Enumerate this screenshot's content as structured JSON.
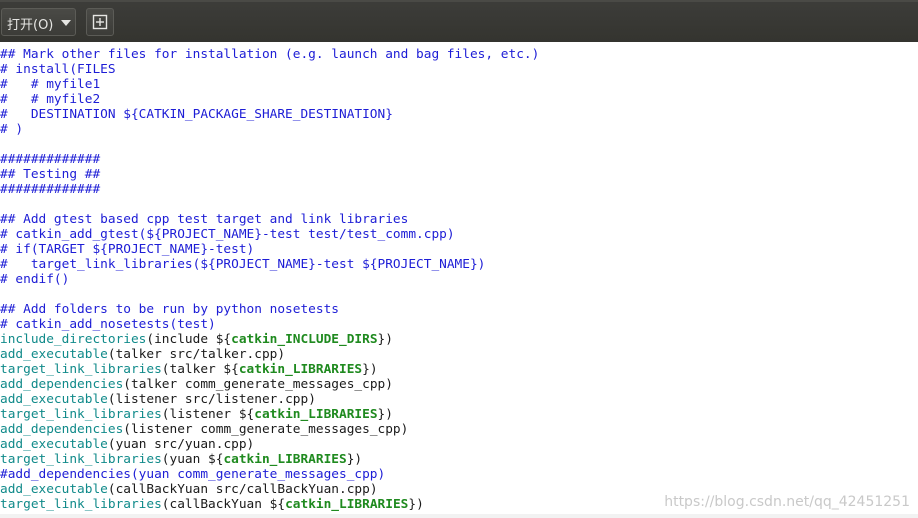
{
  "toolbar": {
    "open_label": "打开(O)",
    "open_icon": "chevron-down-icon",
    "new_icon": "new-document-icon"
  },
  "editor": {
    "lines": [
      [
        {
          "t": "## Mark other files for installation (e.g. launch and bag files, etc.)",
          "c": "comment"
        }
      ],
      [
        {
          "t": "# install(FILES",
          "c": "comment"
        }
      ],
      [
        {
          "t": "#   # myfile1",
          "c": "comment"
        }
      ],
      [
        {
          "t": "#   # myfile2",
          "c": "comment"
        }
      ],
      [
        {
          "t": "#   DESTINATION ${CATKIN_PACKAGE_SHARE_DESTINATION}",
          "c": "comment"
        }
      ],
      [
        {
          "t": "# )",
          "c": "comment"
        }
      ],
      [],
      [
        {
          "t": "#############",
          "c": "comment"
        }
      ],
      [
        {
          "t": "## Testing ##",
          "c": "comment"
        }
      ],
      [
        {
          "t": "#############",
          "c": "comment"
        }
      ],
      [],
      [
        {
          "t": "## Add gtest based cpp test target and link libraries",
          "c": "comment"
        }
      ],
      [
        {
          "t": "# catkin_add_gtest(${PROJECT_NAME}-test test/test_comm.cpp)",
          "c": "comment"
        }
      ],
      [
        {
          "t": "# if(TARGET ${PROJECT_NAME}-test)",
          "c": "comment"
        }
      ],
      [
        {
          "t": "#   target_link_libraries(${PROJECT_NAME}-test ${PROJECT_NAME})",
          "c": "comment"
        }
      ],
      [
        {
          "t": "# endif()",
          "c": "comment"
        }
      ],
      [],
      [
        {
          "t": "## Add folders to be run by python nosetests",
          "c": "comment"
        }
      ],
      [
        {
          "t": "# catkin_add_nosetests(test)",
          "c": "comment"
        }
      ],
      [
        {
          "t": "include_directories",
          "c": "cmd"
        },
        {
          "t": "(include ${",
          "c": "plain"
        },
        {
          "t": "catkin_INCLUDE_DIRS",
          "c": "kw"
        },
        {
          "t": "})",
          "c": "plain"
        }
      ],
      [
        {
          "t": "add_executable",
          "c": "cmd"
        },
        {
          "t": "(talker src/talker.cpp)",
          "c": "plain"
        }
      ],
      [
        {
          "t": "target_link_libraries",
          "c": "cmd"
        },
        {
          "t": "(talker ${",
          "c": "plain"
        },
        {
          "t": "catkin_LIBRARIES",
          "c": "kw"
        },
        {
          "t": "})",
          "c": "plain"
        }
      ],
      [
        {
          "t": "add_dependencies",
          "c": "cmd"
        },
        {
          "t": "(talker comm_generate_messages_cpp)",
          "c": "plain"
        }
      ],
      [
        {
          "t": "add_executable",
          "c": "cmd"
        },
        {
          "t": "(listener src/listener.cpp)",
          "c": "plain"
        }
      ],
      [
        {
          "t": "target_link_libraries",
          "c": "cmd"
        },
        {
          "t": "(listener ${",
          "c": "plain"
        },
        {
          "t": "catkin_LIBRARIES",
          "c": "kw"
        },
        {
          "t": "})",
          "c": "plain"
        }
      ],
      [
        {
          "t": "add_dependencies",
          "c": "cmd"
        },
        {
          "t": "(listener comm_generate_messages_cpp)",
          "c": "plain"
        }
      ],
      [
        {
          "t": "add_executable",
          "c": "cmd"
        },
        {
          "t": "(yuan src/yuan.cpp)",
          "c": "plain"
        }
      ],
      [
        {
          "t": "target_link_libraries",
          "c": "cmd"
        },
        {
          "t": "(yuan ${",
          "c": "plain"
        },
        {
          "t": "catkin_LIBRARIES",
          "c": "kw"
        },
        {
          "t": "})",
          "c": "plain"
        }
      ],
      [
        {
          "t": "#add_dependencies(yuan comm_generate_messages_cpp)",
          "c": "comment"
        }
      ],
      [
        {
          "t": "add_executable",
          "c": "cmd"
        },
        {
          "t": "(callBackYuan src/callBackYuan.cpp)",
          "c": "plain"
        }
      ],
      [
        {
          "t": "target_link_libraries",
          "c": "cmd"
        },
        {
          "t": "(callBackYuan ${",
          "c": "plain"
        },
        {
          "t": "catkin_LIBRARIES",
          "c": "kw"
        },
        {
          "t": "})",
          "c": "plain"
        }
      ]
    ]
  },
  "watermark": "https://blog.csdn.net/qq_42451251",
  "colors": {
    "comment": "#1d1dd6",
    "command": "#108a8a",
    "keyword": "#1f8a1f",
    "toolbar_bg": "#3a3a36"
  }
}
